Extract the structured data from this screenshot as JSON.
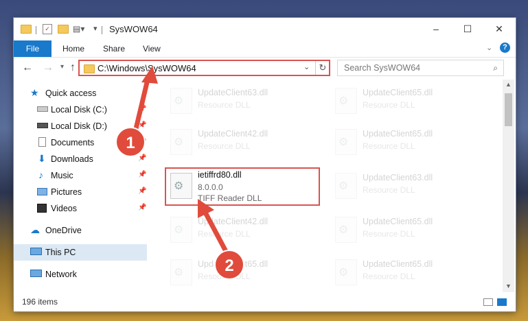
{
  "window": {
    "title": "SysWOW64",
    "controls": {
      "minimize": "–",
      "maximize": "☐",
      "close": "✕"
    }
  },
  "ribbon": {
    "file_label": "File",
    "tabs": [
      "Home",
      "Share",
      "View"
    ],
    "help": "?"
  },
  "address": {
    "path": "C:\\Windows\\SysWOW64",
    "search_placeholder": "Search SysWOW64"
  },
  "nav": {
    "quick_access": "Quick access",
    "items": [
      "Local Disk (C:)",
      "Local Disk (D:)",
      "Documents",
      "Downloads",
      "Music",
      "Pictures",
      "Videos"
    ],
    "onedrive": "OneDrive",
    "this_pc": "This PC",
    "network": "Network"
  },
  "files": [
    {
      "name": "UpdateClient63.dll",
      "desc": "Resource DLL"
    },
    {
      "name": "UpdateClient65.dll",
      "desc": "Resource DLL"
    },
    {
      "name": "UpdateClient42.dll",
      "desc": "Resource DLL"
    },
    {
      "name": "UpdateClient65.dll",
      "desc": "Resource DLL"
    },
    {
      "name": "ietiffrd80.dll",
      "version": "8.0.0.0",
      "desc": "TIFF Reader DLL"
    },
    {
      "name": "UpdateClient63.dll",
      "desc": "Resource DLL"
    },
    {
      "name": "UpdateClient42.dll",
      "desc": "Resource DLL"
    },
    {
      "name": "UpdateClient65.dll",
      "desc": "Resource DLL"
    },
    {
      "name": "UpdateClient65.dll",
      "desc": "Resource DLL"
    },
    {
      "name": "UpdateClient65.dll",
      "desc": "Resource DLL"
    }
  ],
  "status": {
    "count": "196 items"
  },
  "callouts": [
    "1",
    "2"
  ],
  "colors": {
    "accent": "#1979ca",
    "highlight": "#d9534f"
  }
}
